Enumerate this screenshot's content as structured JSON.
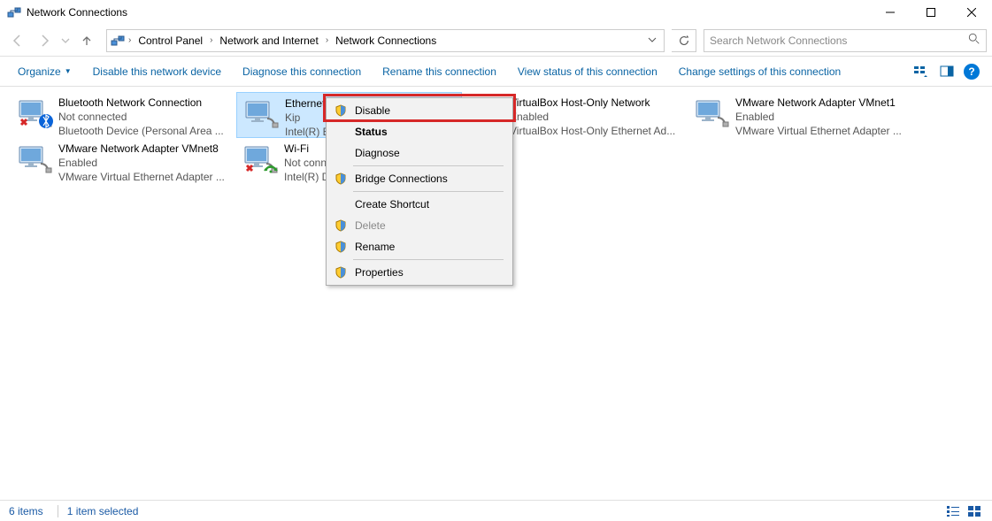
{
  "window": {
    "title": "Network Connections",
    "controls": {
      "min": "—",
      "max": "□",
      "close": "✕"
    }
  },
  "nav": {
    "breadcrumbs": [
      "Control Panel",
      "Network and Internet",
      "Network Connections"
    ],
    "search_placeholder": "Search Network Connections"
  },
  "commands": {
    "organize": "Organize",
    "disable": "Disable this network device",
    "diagnose": "Diagnose this connection",
    "rename": "Rename this connection",
    "viewstatus": "View status of this connection",
    "changesettings": "Change settings of this connection"
  },
  "items": [
    {
      "name": "Bluetooth Network Connection",
      "status": "Not connected",
      "desc": "Bluetooth Device (Personal Area ...",
      "icon": "bt-disconnected",
      "selected": false
    },
    {
      "name": "Ethernet",
      "status": "Kip",
      "desc": "Intel(R) E...",
      "icon": "ethernet",
      "selected": true
    },
    {
      "name": "VirtualBox Host-Only Network",
      "status": "Enabled",
      "desc": "VirtualBox Host-Only Ethernet Ad...",
      "icon": "vbox",
      "selected": false
    },
    {
      "name": "VMware Network Adapter VMnet1",
      "status": "Enabled",
      "desc": "VMware Virtual Ethernet Adapter ...",
      "icon": "vmware",
      "selected": false
    },
    {
      "name": "VMware Network Adapter VMnet8",
      "status": "Enabled",
      "desc": "VMware Virtual Ethernet Adapter ...",
      "icon": "vmware",
      "selected": false
    },
    {
      "name": "Wi-Fi",
      "status": "Not connected",
      "desc": "Intel(R) D...",
      "icon": "wifi-disconnected",
      "selected": false
    }
  ],
  "context_menu": [
    {
      "label": "Disable",
      "shield": true,
      "highlight": true,
      "bold": false,
      "enabled": true,
      "sep_after": false
    },
    {
      "label": "Status",
      "shield": false,
      "highlight": false,
      "bold": true,
      "enabled": true,
      "sep_after": false
    },
    {
      "label": "Diagnose",
      "shield": false,
      "highlight": false,
      "bold": false,
      "enabled": true,
      "sep_after": true
    },
    {
      "label": "Bridge Connections",
      "shield": true,
      "highlight": false,
      "bold": false,
      "enabled": true,
      "sep_after": true
    },
    {
      "label": "Create Shortcut",
      "shield": false,
      "highlight": false,
      "bold": false,
      "enabled": true,
      "sep_after": false
    },
    {
      "label": "Delete",
      "shield": true,
      "highlight": false,
      "bold": false,
      "enabled": false,
      "sep_after": false
    },
    {
      "label": "Rename",
      "shield": true,
      "highlight": false,
      "bold": false,
      "enabled": true,
      "sep_after": true
    },
    {
      "label": "Properties",
      "shield": true,
      "highlight": false,
      "bold": false,
      "enabled": true,
      "sep_after": false
    }
  ],
  "statusbar": {
    "items_count": "6 items",
    "selected": "1 item selected"
  }
}
